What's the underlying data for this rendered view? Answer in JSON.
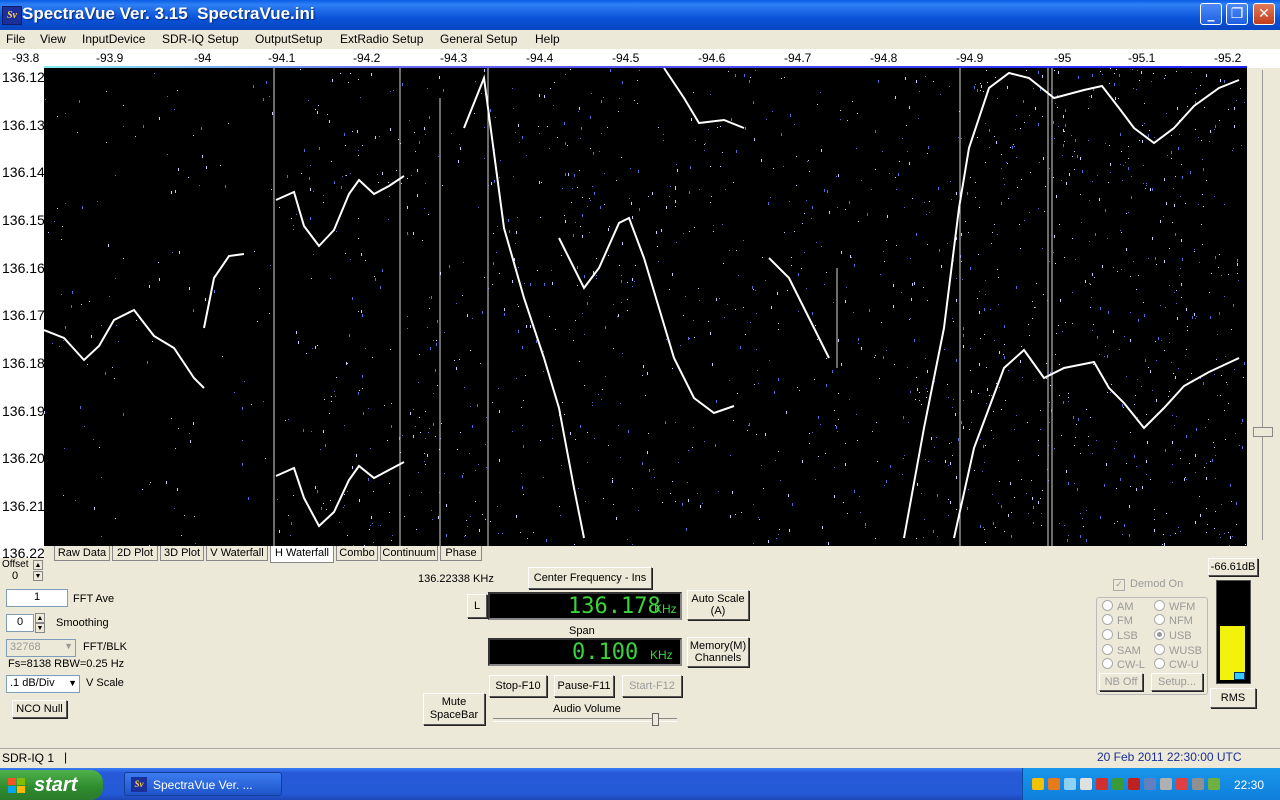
{
  "window": {
    "title": "SpectraVue Ver. 3.15  SpectraVue.ini",
    "logo_text": "Sv",
    "minimize": "_",
    "maximize": "❐",
    "close": "✕"
  },
  "menu": [
    "File",
    "View",
    "InputDevice",
    "SDR-IQ Setup",
    "OutputSetup",
    "ExtRadio Setup",
    "General Setup",
    "Help"
  ],
  "freq_axis": [
    "-93.8",
    "-93.9",
    "-94",
    "-94.1",
    "-94.2",
    "-94.3",
    "-94.4",
    "-94.5",
    "-94.6",
    "-94.7",
    "-94.8",
    "-94.9",
    "-95",
    "-95.1",
    "-95.2"
  ],
  "y_axis": [
    "136.12",
    "136.13",
    "136.14",
    "136.15",
    "136.16",
    "136.17",
    "136.18",
    "136.19",
    "136.20",
    "136.21",
    "136.22"
  ],
  "tabs": [
    "Raw Data",
    "2D Plot",
    "3D Plot",
    "V Waterfall",
    "H Waterfall",
    "Combo",
    "Continuum",
    "Phase"
  ],
  "active_tab": "H Waterfall",
  "controls": {
    "offset_label": "Offset",
    "offset_value": "0",
    "fft_ave_value": "1",
    "fft_ave_label": "FFT Ave",
    "smoothing_value": "0",
    "smoothing_label": "Smoothing",
    "fft_blk_value": "32768",
    "fft_blk_label": "FFT/BLK",
    "fs_info": "Fs=8138 RBW=0.25 Hz",
    "vscale_value": ".1 dB/Div",
    "vscale_label": "V Scale",
    "nco_null": "NCO Null",
    "cursor_freq": "136.22338 KHz",
    "center_freq_button": "Center Frequency - Ins",
    "l_button": "L",
    "center_freq": "136.178",
    "center_unit": "KHz",
    "span_label": "Span",
    "span_value": "0.100",
    "span_unit": "KHz",
    "auto_scale": "Auto Scale\n(A)",
    "memory": "Memory(M)\nChannels",
    "mute": "Mute\nSpaceBar",
    "stop": "Stop-F10",
    "pause": "Pause-F11",
    "start": "Start-F12",
    "audio_volume_label": "Audio Volume",
    "audio_volume": 0.88
  },
  "demod": {
    "label": "Demod On",
    "options": [
      "AM",
      "WFM",
      "FM",
      "NFM",
      "LSB",
      "USB",
      "SAM",
      "WUSB",
      "CW-L",
      "CW-U"
    ],
    "selected": "USB",
    "nb_button": "NB Off",
    "setup_button": "Setup..."
  },
  "meter": {
    "db_readout": "-66.61dB",
    "rms_button": "RMS",
    "level": 0.55
  },
  "status": {
    "device": "SDR-IQ 1",
    "datetime": "20 Feb 2011   22:30:00 UTC"
  },
  "taskbar": {
    "start": "start",
    "task": "SpectraVue Ver. ...",
    "clock": "22:30"
  },
  "colors": {
    "titlebar": "#0a53d8",
    "digits": "#3bd33b",
    "meter": "#f2f20a"
  }
}
